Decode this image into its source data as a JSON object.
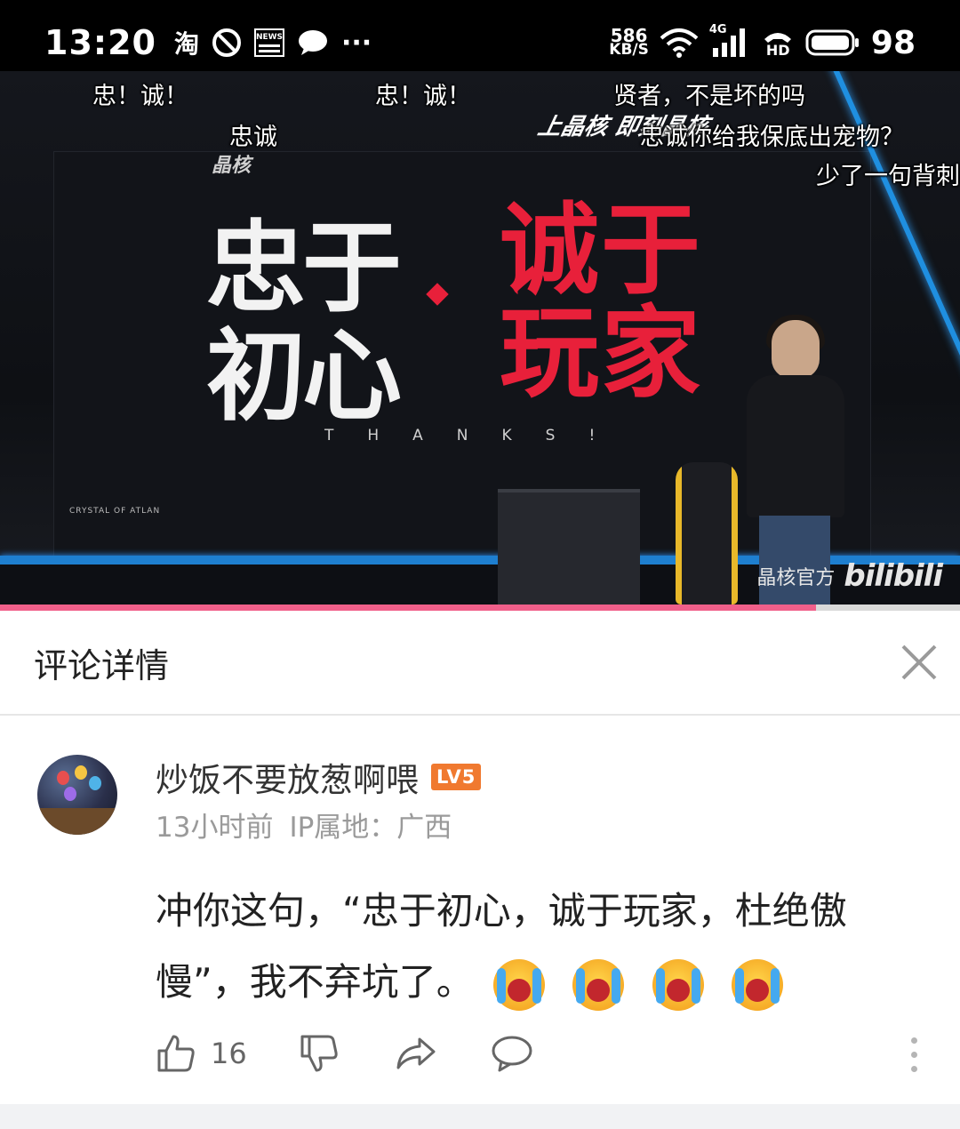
{
  "status_bar": {
    "time": "13:20",
    "app_glyph": "淘",
    "news_label": "NEWS",
    "more_dots": "···",
    "net_speed_value": "586",
    "net_speed_unit": "KB/S",
    "network_type": "4G",
    "hd_label": "HD",
    "battery": "98"
  },
  "video": {
    "danmaku": [
      "忠！诚！",
      "忠！诚！",
      "贤者，不是坏的吗",
      "忠诚",
      "忠诚你给我保底出宠物？",
      "少了一句背刺"
    ],
    "screen_text": {
      "left_chars": [
        "忠",
        "于",
        "初",
        "心"
      ],
      "right_chars": [
        "诚",
        "于",
        "玩",
        "家"
      ],
      "thanks": "THANKS!",
      "brand_mini": "晶核",
      "slogan": "上晶核 即刻晶核",
      "crystal_label": "CRYSTAL OF ATLAN"
    },
    "watermark_text": "晶核官方",
    "watermark_logo": "bilibili",
    "progress": 0.85,
    "colors": {
      "progress_fill": "#f05f8a",
      "beam": "#1f8fe0",
      "red_text": "#e8203a"
    }
  },
  "panel": {
    "title": "评论详情",
    "close_icon": "close-icon"
  },
  "comment": {
    "username": "炒饭不要放葱啊喂",
    "level": "LV5",
    "time": "13小时前",
    "ip": "IP属地：广西",
    "text": "冲你这句，“忠于初心，诚于玩家，杜绝傲慢”，我不弃坑了。",
    "emojis": [
      "crying-emoji",
      "crying-emoji",
      "crying-emoji",
      "crying-emoji"
    ],
    "likes": "16",
    "colors": {
      "level_badge": "#f0792f"
    }
  }
}
